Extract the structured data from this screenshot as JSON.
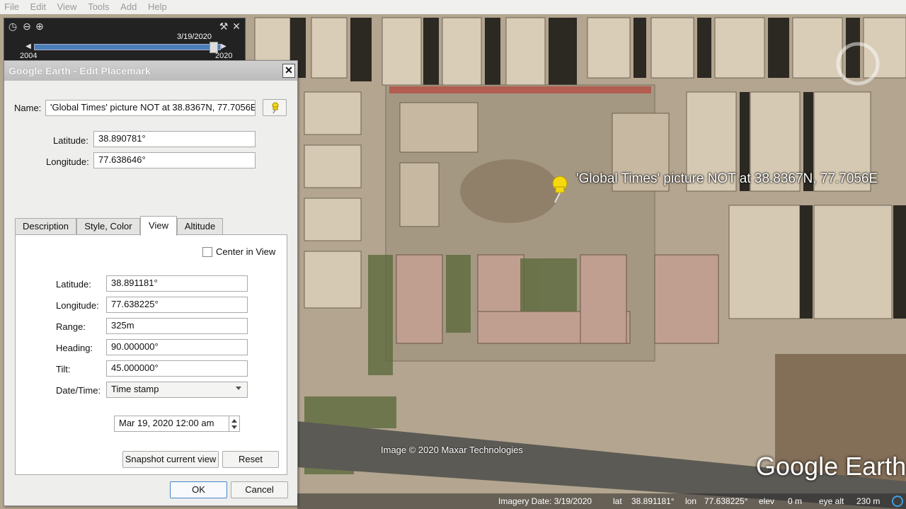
{
  "menu": {
    "items": [
      "File",
      "Edit",
      "View",
      "Tools",
      "Add",
      "Help"
    ]
  },
  "time_slider": {
    "current_date": "3/19/2020",
    "start_year": "2004",
    "end_year": "2020",
    "position_fraction": 0.96
  },
  "dialog": {
    "title": "Google Earth - Edit Placemark",
    "name_label": "Name:",
    "name_value": "'Global Times' picture NOT at 38.8367N, 77.7056E",
    "latitude_label": "Latitude:",
    "latitude_value": "38.890781°",
    "longitude_label": "Longitude:",
    "longitude_value": "77.638646°",
    "tabs": [
      {
        "label": "Description",
        "active": false
      },
      {
        "label": "Style, Color",
        "active": false
      },
      {
        "label": "View",
        "active": true
      },
      {
        "label": "Altitude",
        "active": false
      }
    ],
    "view": {
      "center_in_view_label": "Center in View",
      "center_in_view_checked": false,
      "latitude_label": "Latitude:",
      "latitude_value": "38.891181°",
      "longitude_label": "Longitude:",
      "longitude_value": "77.638225°",
      "range_label": "Range:",
      "range_value": "325m",
      "heading_label": "Heading:",
      "heading_value": "90.000000°",
      "tilt_label": "Tilt:",
      "tilt_value": "45.000000°",
      "datetime_label": "Date/Time:",
      "datetime_selected": "Time stamp",
      "timestamp_value": "Mar 19, 2020 12:00 am",
      "snapshot_label": "Snapshot current view",
      "reset_label": "Reset"
    },
    "ok_label": "OK",
    "cancel_label": "Cancel"
  },
  "map": {
    "placemark_label": "'Global Times' picture NOT at 38.8367N, 77.7056E",
    "copyright": "Image © 2020 Maxar Technologies",
    "brand": "Google Earth"
  },
  "status": {
    "imagery_date": "Imagery Date: 3/19/2020",
    "lat_label": "lat",
    "lat_value": "38.891181°",
    "lon_label": "lon",
    "lon_value": "77.638225°",
    "elev_label": "elev",
    "elev_value": "0 m",
    "eye_label": "eye alt",
    "eye_value": "230 m"
  },
  "colors": {
    "pin": "#f5d90f",
    "slider": "#4a7fb9",
    "ok_border": "#4a86c8"
  }
}
